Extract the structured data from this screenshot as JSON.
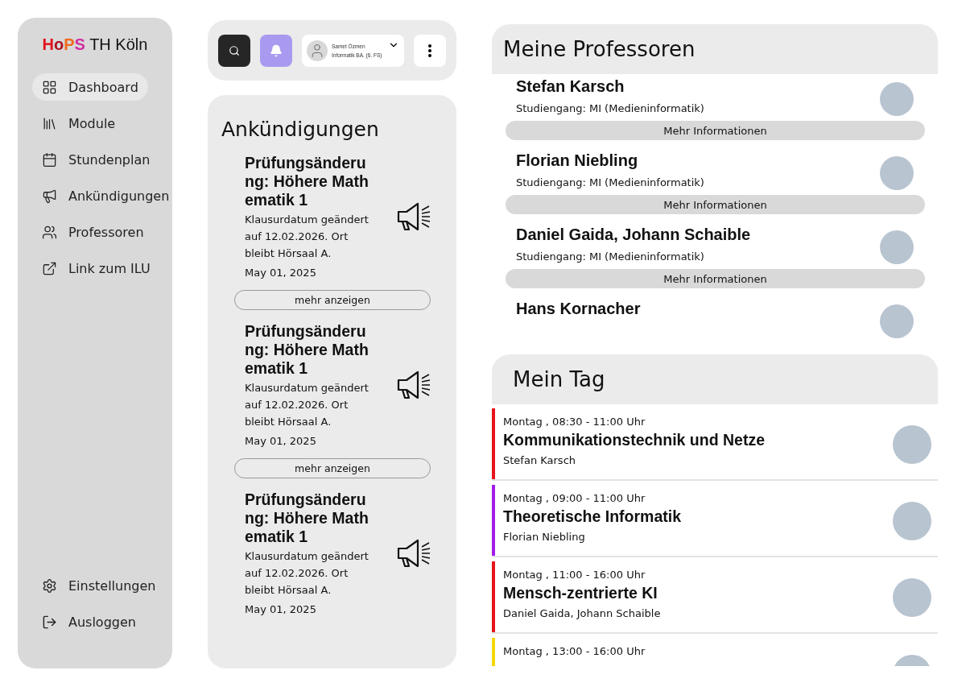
{
  "sidebar": {
    "logo": [
      {
        "text": "H",
        "color": "#e0141e"
      },
      {
        "text": "o",
        "color": "#b01020"
      },
      {
        "text": "P",
        "color": "#f06a1c"
      },
      {
        "text": "S",
        "color": "#d02ca0"
      }
    ],
    "logo_suffix": "TH Köln",
    "items": [
      {
        "label": "Dashboard",
        "selected": true
      },
      {
        "label": "Module",
        "selected": false
      },
      {
        "label": "Stundenplan",
        "selected": false
      },
      {
        "label": "Ankündigungen",
        "selected": false
      },
      {
        "label": "Professoren",
        "selected": false
      },
      {
        "label": "Link zum ILU",
        "selected": false
      }
    ],
    "bottom_items": [
      {
        "label": "Einstellungen"
      },
      {
        "label": "Ausloggen"
      }
    ]
  },
  "topbar": {
    "user_name": "Samet Özmen",
    "user_program": "Informatik BA. (6. FS)"
  },
  "announcements": {
    "title": "Ankündigungen",
    "items": [
      {
        "title": "Prüfungsänderung: Höhere Mathematik 1",
        "text": "Klausurdatum geändert auf 12.02.2026. Ort bleibt Hörsaal A.",
        "date": "May 01, 2025",
        "button": "mehr anzeigen"
      },
      {
        "title": "Prüfungsänderung: Höhere Mathematik 1",
        "text": "Klausurdatum geändert auf 12.02.2026. Ort bleibt Hörsaal A.",
        "date": "May 01, 2025",
        "button": "mehr anzeigen"
      },
      {
        "title": "Prüfungsänderung: Höhere Mathematik 1",
        "text": "Klausurdatum geändert auf 12.02.2026. Ort bleibt Hörsaal A.",
        "date": "May 01, 2025"
      }
    ]
  },
  "professors": {
    "title": "Meine Professoren",
    "items": [
      {
        "name": "Stefan Karsch",
        "program": "Studiengang: MI (Medieninformatik)",
        "button": "Mehr Informationen"
      },
      {
        "name": "Florian Niebling",
        "program": "Studiengang: MI (Medieninformatik)",
        "button": "Mehr Informationen"
      },
      {
        "name": "Daniel Gaida, Johann Schaible",
        "program": "Studiengang: MI (Medieninformatik)",
        "button": "Mehr Informationen"
      },
      {
        "name": "Hans Kornacher"
      }
    ]
  },
  "day": {
    "title": "Mein Tag",
    "items": [
      {
        "time": "Montag , 08:30 - 11:00 Uhr",
        "course": "Kommunikationstechnik und Netze",
        "lecturer": "Stefan Karsch",
        "color": "#e8131b"
      },
      {
        "time": "Montag , 09:00 - 11:00 Uhr",
        "course": "Theoretische Informatik",
        "lecturer": "Florian Niebling",
        "color": "#a21ce8"
      },
      {
        "time": "Montag , 11:00 - 16:00 Uhr",
        "course": "Mensch-zentrierte KI",
        "lecturer": "Daniel Gaida, Johann Schaible",
        "color": "#e8131b"
      },
      {
        "time": "Montag , 13:00 - 16:00 Uhr",
        "color": "#f5d60a"
      }
    ]
  }
}
